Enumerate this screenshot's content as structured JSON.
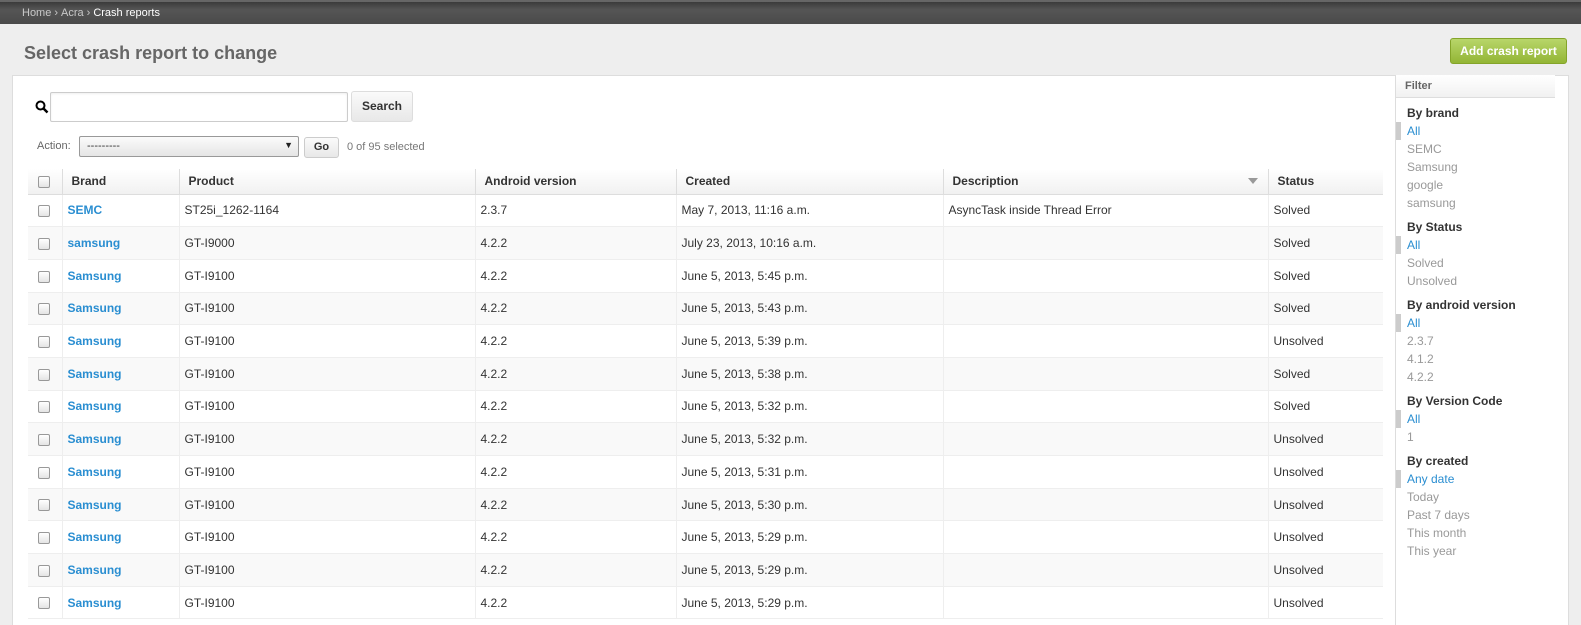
{
  "breadcrumb": {
    "home": "Home",
    "app": "Acra",
    "current": "Crash reports",
    "sep": "›"
  },
  "page_title": "Select crash report to change",
  "add_button": "Add crash report",
  "search": {
    "value": "",
    "button": "Search"
  },
  "action": {
    "label": "Action:",
    "selected": "---------",
    "go": "Go",
    "count": "0 of 95 selected"
  },
  "columns": [
    "Brand",
    "Product",
    "Android version",
    "Created",
    "Description",
    "Status"
  ],
  "rows": [
    {
      "brand": "SEMC",
      "product": "ST25i_1262-1164",
      "android": "2.3.7",
      "created": "May 7, 2013, 11:16 a.m.",
      "description": "AsyncTask inside Thread Error",
      "status": "Solved"
    },
    {
      "brand": "samsung",
      "product": "GT-I9000",
      "android": "4.2.2",
      "created": "July 23, 2013, 10:16 a.m.",
      "description": "",
      "status": "Solved"
    },
    {
      "brand": "Samsung",
      "product": "GT-I9100",
      "android": "4.2.2",
      "created": "June 5, 2013, 5:45 p.m.",
      "description": "",
      "status": "Solved"
    },
    {
      "brand": "Samsung",
      "product": "GT-I9100",
      "android": "4.2.2",
      "created": "June 5, 2013, 5:43 p.m.",
      "description": "",
      "status": "Solved"
    },
    {
      "brand": "Samsung",
      "product": "GT-I9100",
      "android": "4.2.2",
      "created": "June 5, 2013, 5:39 p.m.",
      "description": "",
      "status": "Unsolved"
    },
    {
      "brand": "Samsung",
      "product": "GT-I9100",
      "android": "4.2.2",
      "created": "June 5, 2013, 5:38 p.m.",
      "description": "",
      "status": "Solved"
    },
    {
      "brand": "Samsung",
      "product": "GT-I9100",
      "android": "4.2.2",
      "created": "June 5, 2013, 5:32 p.m.",
      "description": "",
      "status": "Solved"
    },
    {
      "brand": "Samsung",
      "product": "GT-I9100",
      "android": "4.2.2",
      "created": "June 5, 2013, 5:32 p.m.",
      "description": "",
      "status": "Unsolved"
    },
    {
      "brand": "Samsung",
      "product": "GT-I9100",
      "android": "4.2.2",
      "created": "June 5, 2013, 5:31 p.m.",
      "description": "",
      "status": "Unsolved"
    },
    {
      "brand": "Samsung",
      "product": "GT-I9100",
      "android": "4.2.2",
      "created": "June 5, 2013, 5:30 p.m.",
      "description": "",
      "status": "Unsolved"
    },
    {
      "brand": "Samsung",
      "product": "GT-I9100",
      "android": "4.2.2",
      "created": "June 5, 2013, 5:29 p.m.",
      "description": "",
      "status": "Unsolved"
    },
    {
      "brand": "Samsung",
      "product": "GT-I9100",
      "android": "4.2.2",
      "created": "June 5, 2013, 5:29 p.m.",
      "description": "",
      "status": "Unsolved"
    },
    {
      "brand": "Samsung",
      "product": "GT-I9100",
      "android": "4.2.2",
      "created": "June 5, 2013, 5:29 p.m.",
      "description": "",
      "status": "Unsolved"
    }
  ],
  "filter": {
    "title": "Filter",
    "groups": [
      {
        "title": "By brand",
        "items": [
          "All",
          "SEMC",
          "Samsung",
          "google",
          "samsung"
        ],
        "selected": 0
      },
      {
        "title": "By Status",
        "items": [
          "All",
          "Solved",
          "Unsolved"
        ],
        "selected": 0
      },
      {
        "title": "By android version",
        "items": [
          "All",
          "2.3.7",
          "4.1.2",
          "4.2.2"
        ],
        "selected": 0
      },
      {
        "title": "By Version Code",
        "items": [
          "All",
          "1"
        ],
        "selected": 0
      },
      {
        "title": "By created",
        "items": [
          "Any date",
          "Today",
          "Past 7 days",
          "This month",
          "This year"
        ],
        "selected": 0
      }
    ]
  },
  "colors": {
    "link": "#2a8ed1",
    "add_button": "#9dbd3f"
  }
}
